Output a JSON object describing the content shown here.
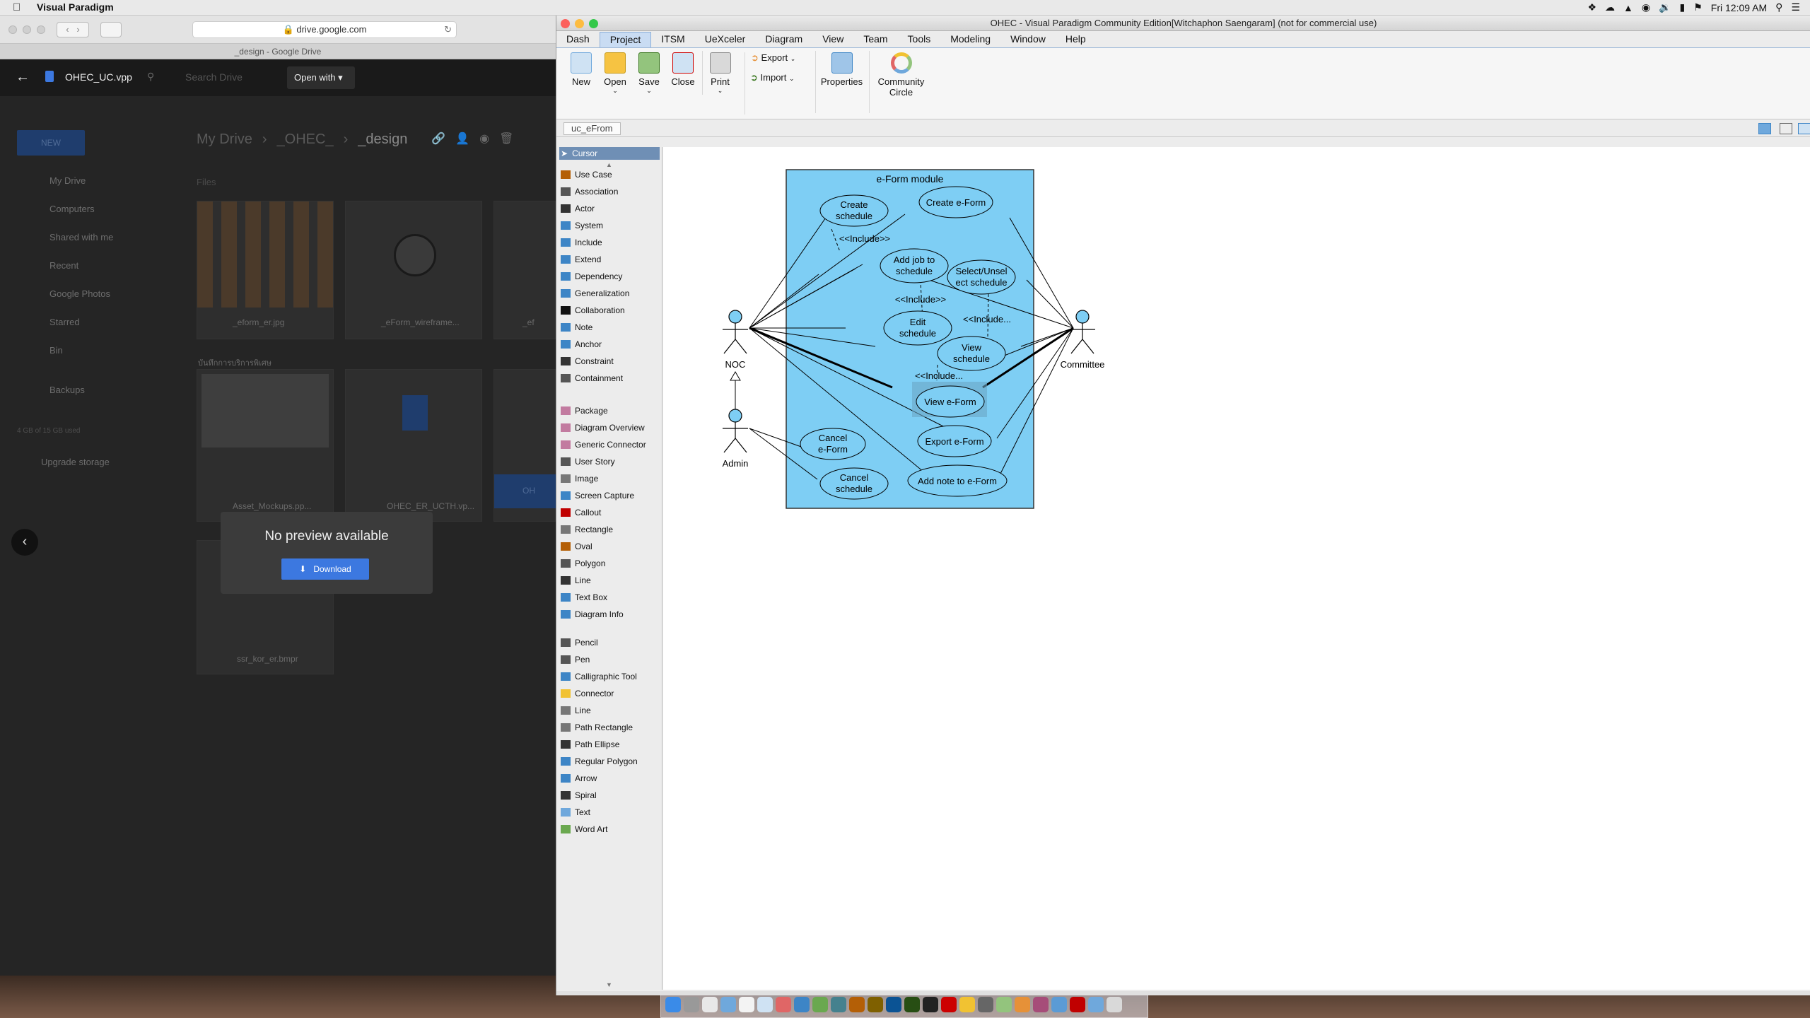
{
  "menubar": {
    "app_name": "Visual Paradigm",
    "clock": "Fri 12:09 AM"
  },
  "safari": {
    "url": "drive.google.com",
    "tab_title": "_design - Google Drive"
  },
  "drive": {
    "file_name": "OHEC_UC.vpp",
    "search_placeholder": "Search Drive",
    "open_with": "Open with",
    "new_button": "NEW",
    "breadcrumb": [
      "My Drive",
      "_OHEC_",
      "_design"
    ],
    "files_heading": "Files",
    "nav": [
      "My Drive",
      "Computers",
      "Shared with me",
      "Recent",
      "Google Photos",
      "Starred",
      "Bin",
      "Backups"
    ],
    "storage": "4 GB of 15 GB used",
    "upgrade": "Upgrade storage",
    "thumbs": [
      "_eform_er.jpg",
      "_eForm_wireframe...",
      "_ef",
      "Asset_Mockups.pp...",
      "OHEC_ER_UCTH.vp...",
      "OH",
      "ssr_kor_er.bmpr"
    ],
    "thai_caption": "บันทึกการบริการพิเศษ",
    "preview_text": "No preview available",
    "download": "Download"
  },
  "vp": {
    "title": "OHEC - Visual Paradigm Community Edition[Witchaphon Saengaram] (not for commercial use)",
    "menu": [
      "Dash",
      "Project",
      "ITSM",
      "UeXceler",
      "Diagram",
      "View",
      "Team",
      "Tools",
      "Modeling",
      "Window",
      "Help"
    ],
    "ribbon": {
      "new": "New",
      "open": "Open",
      "save": "Save",
      "close": "Close",
      "print": "Print",
      "export": "Export",
      "import": "Import",
      "properties": "Properties",
      "community_line1": "Community",
      "community_line2": "Circle"
    },
    "breadcrumb": "uc_eFrom",
    "palette_top": "Cursor",
    "palette_group1": [
      "Use Case",
      "Association",
      "Actor",
      "System",
      "Include",
      "Extend",
      "Dependency",
      "Generalization",
      "Collaboration",
      "Note",
      "Anchor",
      "Constraint",
      "Containment"
    ],
    "palette_group2": [
      "Package",
      "Diagram Overview",
      "Generic Connector",
      "User Story",
      "Image",
      "Screen Capture",
      "Callout",
      "Rectangle",
      "Oval",
      "Polygon",
      "Line",
      "Text Box",
      "Diagram Info"
    ],
    "palette_group3": [
      "Pencil",
      "Pen",
      "Calligraphic Tool",
      "Connector",
      "Line",
      "Path Rectangle",
      "Path Ellipse",
      "Regular Polygon",
      "Arrow",
      "Spiral",
      "Text",
      "Word Art"
    ]
  },
  "diagram": {
    "system_title": "e-Form module",
    "actors": {
      "noc": "NOC",
      "admin": "Admin",
      "committee": "Committee"
    },
    "usecases": {
      "create_schedule": [
        "Create",
        "schedule"
      ],
      "create_eform": [
        "Create e-Form"
      ],
      "add_job": [
        "Add job to",
        "schedule"
      ],
      "select_schedule": [
        "Select/Unsel",
        "ect schedule"
      ],
      "edit_schedule": [
        "Edit",
        "schedule"
      ],
      "view_schedule": [
        "View",
        "schedule"
      ],
      "view_eform": [
        "View e-Form"
      ],
      "cancel_eform": [
        "Cancel",
        "e-Form"
      ],
      "export_eform": [
        "Export e-Form"
      ],
      "cancel_schedule": [
        "Cancel",
        "schedule"
      ],
      "add_note": [
        "Add note to e-Form"
      ]
    },
    "include_labels": [
      "<<Include>>",
      "<<Include>>",
      "<<Include...",
      "<<Include..."
    ]
  }
}
